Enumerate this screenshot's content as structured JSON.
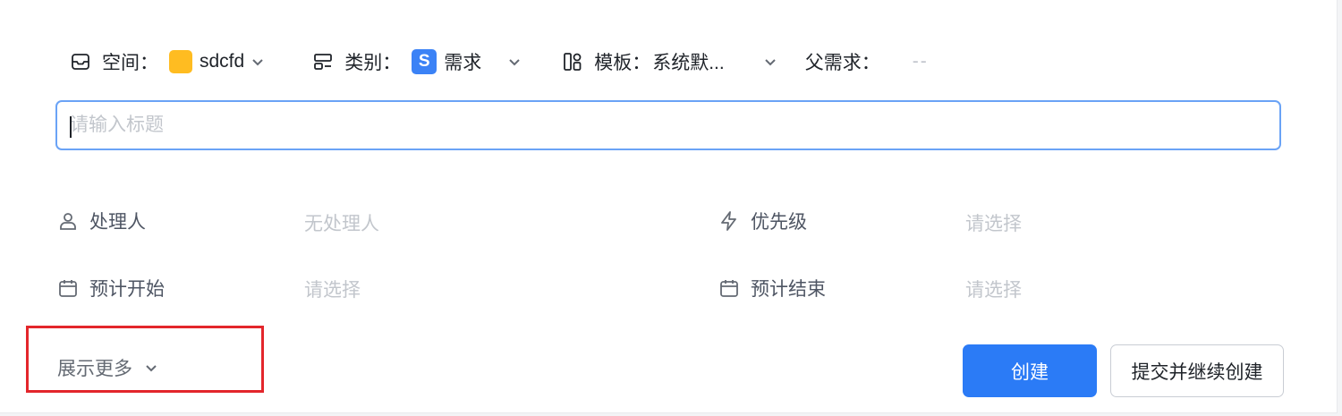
{
  "meta": {
    "space": {
      "label": "空间：",
      "value": "sdcfd",
      "color": "#ffbc21"
    },
    "category": {
      "label": "类别：",
      "badge": "S",
      "value": "需求",
      "badge_color": "#3b82f6"
    },
    "template": {
      "label": "模板：",
      "value": "系统默..."
    },
    "parent": {
      "label": "父需求：",
      "value": "--"
    }
  },
  "title_input": {
    "placeholder": "请输入标题",
    "value": ""
  },
  "fields": {
    "assignee": {
      "label": "处理人",
      "value": "无处理人",
      "icon": "user-icon"
    },
    "priority": {
      "label": "优先级",
      "value": "请选择",
      "icon": "lightning-icon"
    },
    "start": {
      "label": "预计开始",
      "value": "请选择",
      "icon": "calendar-icon"
    },
    "end": {
      "label": "预计结束",
      "value": "请选择",
      "icon": "calendar-icon"
    }
  },
  "show_more": {
    "label": "展示更多"
  },
  "buttons": {
    "create": "创建",
    "submit_continue": "提交并继续创建"
  },
  "colors": {
    "primary": "#2b7bf6",
    "highlight_box": "#e3262b"
  }
}
